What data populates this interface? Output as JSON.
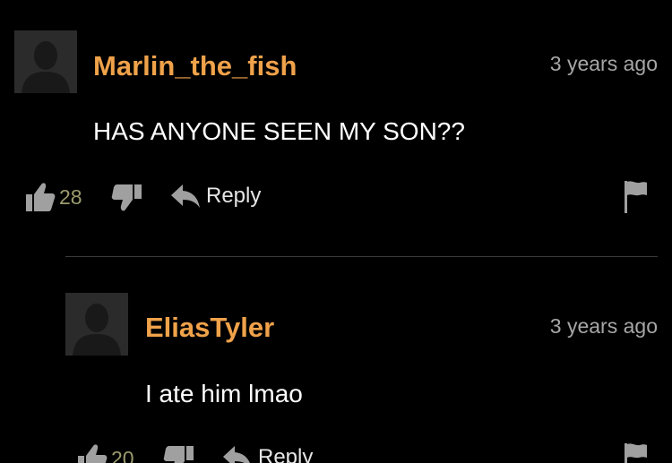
{
  "comments": [
    {
      "username": "Marlin_the_fish",
      "timestamp": "3 years ago",
      "text": "HAS ANYONE SEEN MY SON??",
      "likes": "28",
      "reply_label": "Reply"
    },
    {
      "username": "EliasTyler",
      "timestamp": "3 years ago",
      "text": "I ate him lmao",
      "likes": "20",
      "reply_label": "Reply"
    }
  ],
  "colors": {
    "username": "#f0a24a",
    "timestamp": "#a6a6a6",
    "background": "#000000",
    "icon": "#a0a0a0"
  },
  "icons": [
    "avatar-silhouette-icon",
    "thumbs-up-icon",
    "thumbs-down-icon",
    "reply-arrow-icon",
    "flag-icon"
  ]
}
